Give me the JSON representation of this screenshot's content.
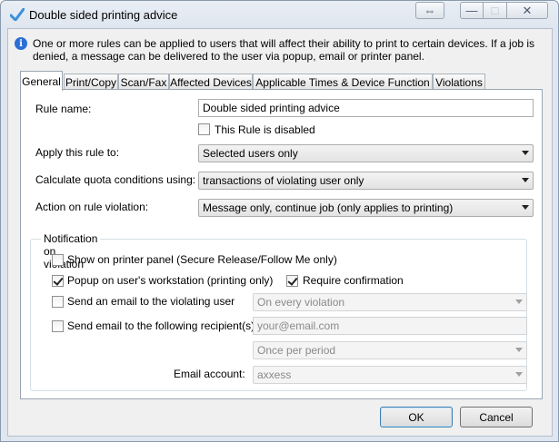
{
  "window": {
    "title": "Double sided printing advice",
    "controls": {
      "move": "⇔",
      "minimize": "—",
      "maximize": "□",
      "close": "✕"
    }
  },
  "info": {
    "text": "One or more rules can be applied to users that will affect their ability to print to certain devices. If a job is denied, a message can be delivered to the user via popup, email or printer panel."
  },
  "tabs": [
    {
      "label": "General"
    },
    {
      "label": "Print/Copy"
    },
    {
      "label": "Scan/Fax"
    },
    {
      "label": "Affected Devices"
    },
    {
      "label": "Applicable Times & Device Function"
    },
    {
      "label": "Violations"
    }
  ],
  "general": {
    "rule_name_label": "Rule name:",
    "rule_name_value": "Double sided printing advice",
    "disabled_label": "This Rule is disabled",
    "disabled_checked": false,
    "apply_label": "Apply this rule to:",
    "apply_value": "Selected users only",
    "quota_label": "Calculate quota conditions using:",
    "quota_value": "transactions of violating user only",
    "action_label": "Action on rule violation:",
    "action_value": "Message only, continue job (only applies to printing)"
  },
  "notification": {
    "title": "Notification on violation",
    "show_panel_label": "Show on printer panel (Secure Release/Follow Me only)",
    "show_panel_checked": false,
    "popup_label": "Popup on user's workstation (printing only)",
    "popup_checked": true,
    "require_confirm_label": "Require confirmation",
    "require_confirm_checked": true,
    "send_email_user_label": "Send an email to the violating user",
    "send_email_user_checked": false,
    "email_user_frequency": "On every violation",
    "send_email_recipients_label": "Send email to the following recipient(s):",
    "send_email_recipients_checked": false,
    "recipients_placeholder": "your@email.com",
    "recipients_frequency": "Once per period",
    "email_account_label": "Email account:",
    "email_account_value": "axxess"
  },
  "buttons": {
    "ok": "OK",
    "cancel": "Cancel"
  }
}
